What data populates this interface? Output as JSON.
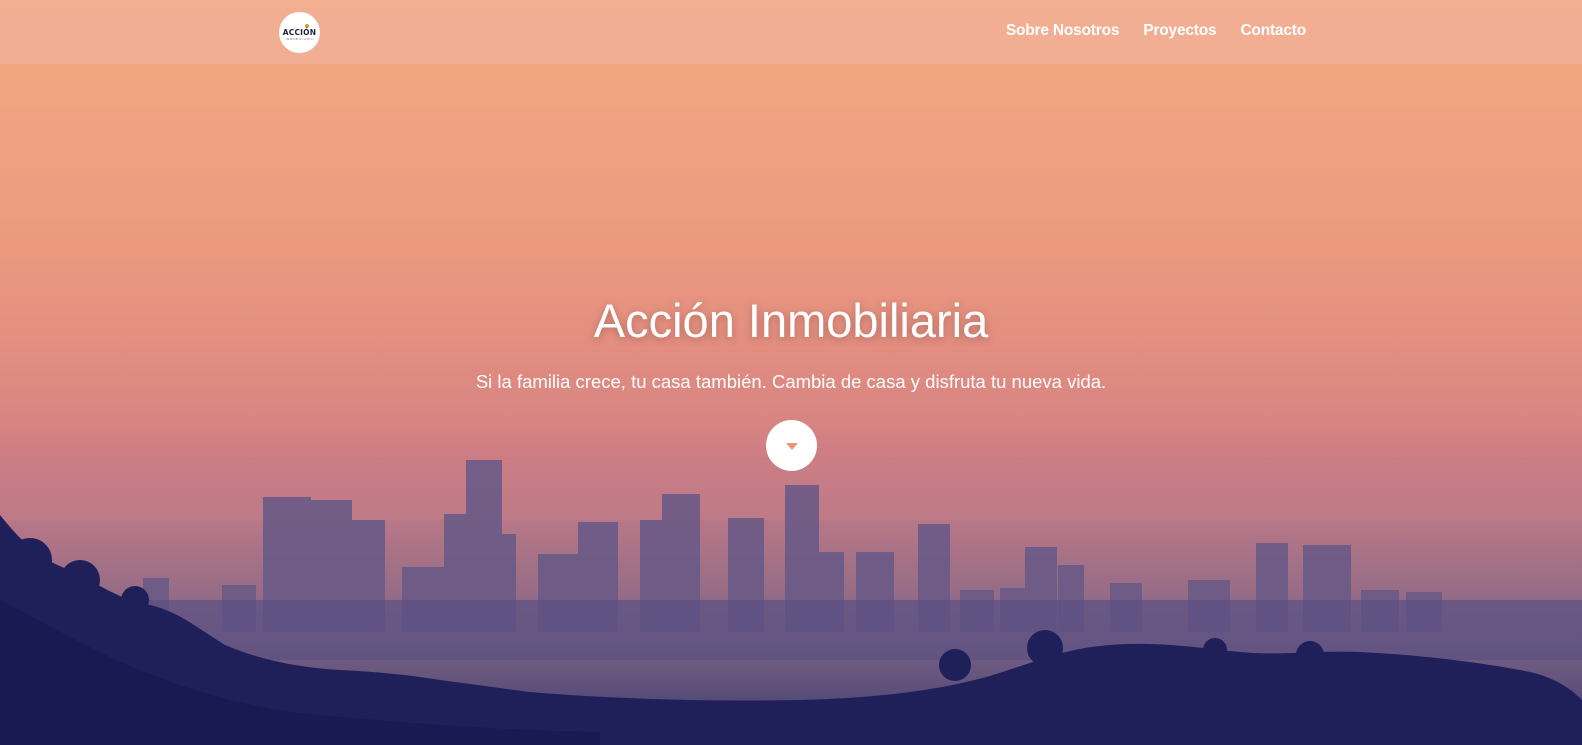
{
  "brand": {
    "logo_text": "ACCIÓN",
    "logo_subtext": "INMOBILIARIA",
    "accent_color": "#e8922f"
  },
  "nav": {
    "items": [
      {
        "label": "Sobre Nosotros"
      },
      {
        "label": "Proyectos"
      },
      {
        "label": "Contacto"
      }
    ]
  },
  "hero": {
    "title": "Acción Inmobiliaria",
    "subtitle": "Si la familia crece, tu casa también. Cambia de casa y disfruta tu nueva vida.",
    "scroll_icon": "caret-down-icon",
    "background": "city-skyline-at-dusk"
  },
  "colors": {
    "navbar_bg": "#f2b096",
    "caret": "#ef9276",
    "silhouette": "#1f1f5a"
  }
}
